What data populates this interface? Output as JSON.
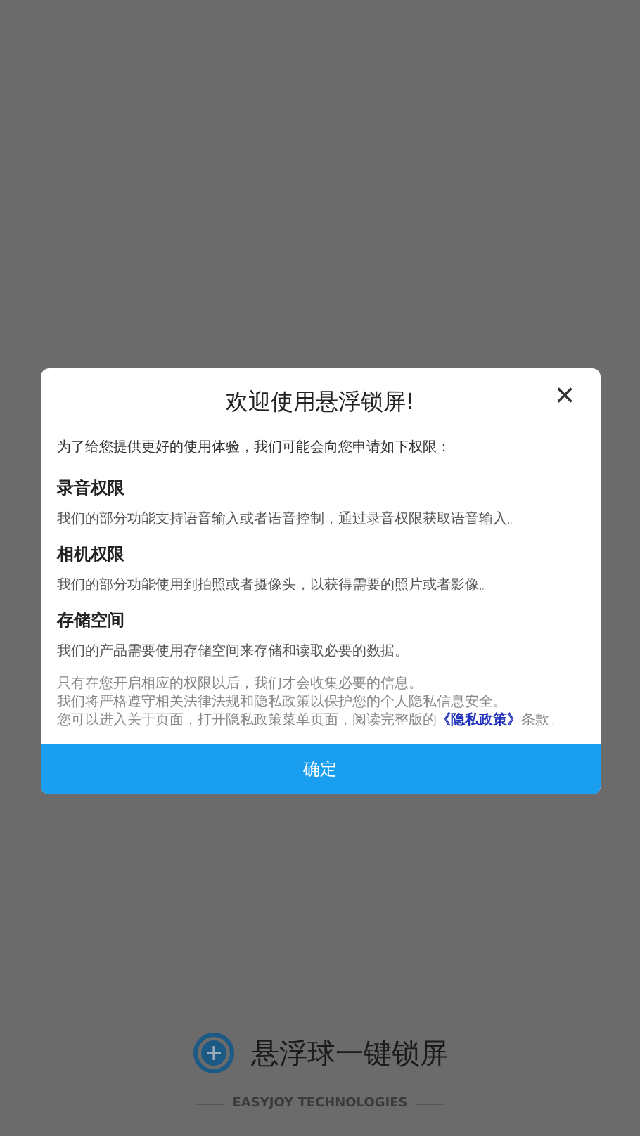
{
  "dialog": {
    "title": "欢迎使用悬浮锁屏!",
    "close": "×",
    "intro": "为了给您提供更好的使用体验，我们可能会向您申请如下权限：",
    "permissions": [
      {
        "name": "录音权限",
        "description": "我们的部分功能支持语音输入或者语音控制，通过录音权限获取语音输入。"
      },
      {
        "name": "相机权限",
        "description": "我们的部分功能使用到拍照或者摄像头，以获得需要的照片或者影像。"
      },
      {
        "name": "存储空间",
        "description": "我们的产品需要使用存储空间来存储和读取必要的数据。"
      }
    ],
    "notice": [
      "只有在您开启相应的权限以后，我们才会收集必要的信息。",
      "我们将严格遵守相关法律法规和隐私政策以保护您的个人隐私信息安全。"
    ],
    "notice_last": {
      "before": "您可以进入关于页面，打开隐私政策菜单页面，阅读完整版的",
      "link": "《隐私政策》",
      "after": "条款。"
    },
    "confirm": "确定"
  },
  "brand": {
    "name": "悬浮球一键锁屏",
    "company": "EASYJOY TECHNOLOGIES"
  }
}
